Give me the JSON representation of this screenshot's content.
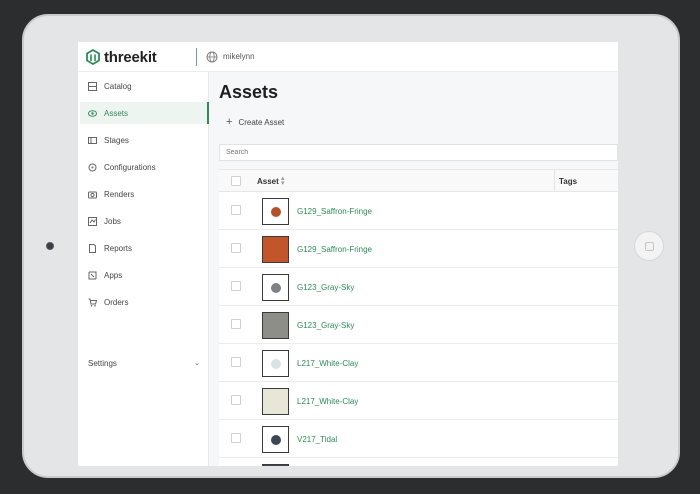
{
  "app": {
    "logo_text": "threekit",
    "org_name": "mikelynn"
  },
  "sidebar": {
    "items": [
      {
        "label": "Catalog",
        "icon": "catalog-icon",
        "active": false
      },
      {
        "label": "Assets",
        "icon": "assets-icon",
        "active": true
      },
      {
        "label": "Stages",
        "icon": "stages-icon",
        "active": false
      },
      {
        "label": "Configurations",
        "icon": "configurations-icon",
        "active": false
      },
      {
        "label": "Renders",
        "icon": "renders-icon",
        "active": false
      },
      {
        "label": "Jobs",
        "icon": "jobs-icon",
        "active": false
      },
      {
        "label": "Reports",
        "icon": "reports-icon",
        "active": false
      },
      {
        "label": "Apps",
        "icon": "apps-icon",
        "active": false
      },
      {
        "label": "Orders",
        "icon": "orders-icon",
        "active": false
      }
    ],
    "settings_label": "Settings"
  },
  "main": {
    "title": "Assets",
    "create_label": "Create Asset",
    "search_placeholder": "Search",
    "columns": {
      "asset": "Asset",
      "tags": "Tags"
    },
    "rows": [
      {
        "name": "G129_Saffron-Fringe",
        "thumb": "ball",
        "color": "#b4502a"
      },
      {
        "name": "G129_Saffron-Fringe",
        "thumb": "swatch",
        "color": "#c2552a"
      },
      {
        "name": "G123_Gray-Sky",
        "thumb": "ball",
        "color": "#7e8083"
      },
      {
        "name": "G123_Gray-Sky",
        "thumb": "swatch",
        "color": "#8e8e88"
      },
      {
        "name": "L217_White-Clay",
        "thumb": "ball",
        "color": "#d9e3e6"
      },
      {
        "name": "L217_White-Clay",
        "thumb": "swatch",
        "color": "#e8e6d6"
      },
      {
        "name": "V217_Tidal",
        "thumb": "ball",
        "color": "#3e4854"
      }
    ]
  },
  "colors": {
    "accent": "#2e8b57",
    "background": "#2b2d2f"
  }
}
